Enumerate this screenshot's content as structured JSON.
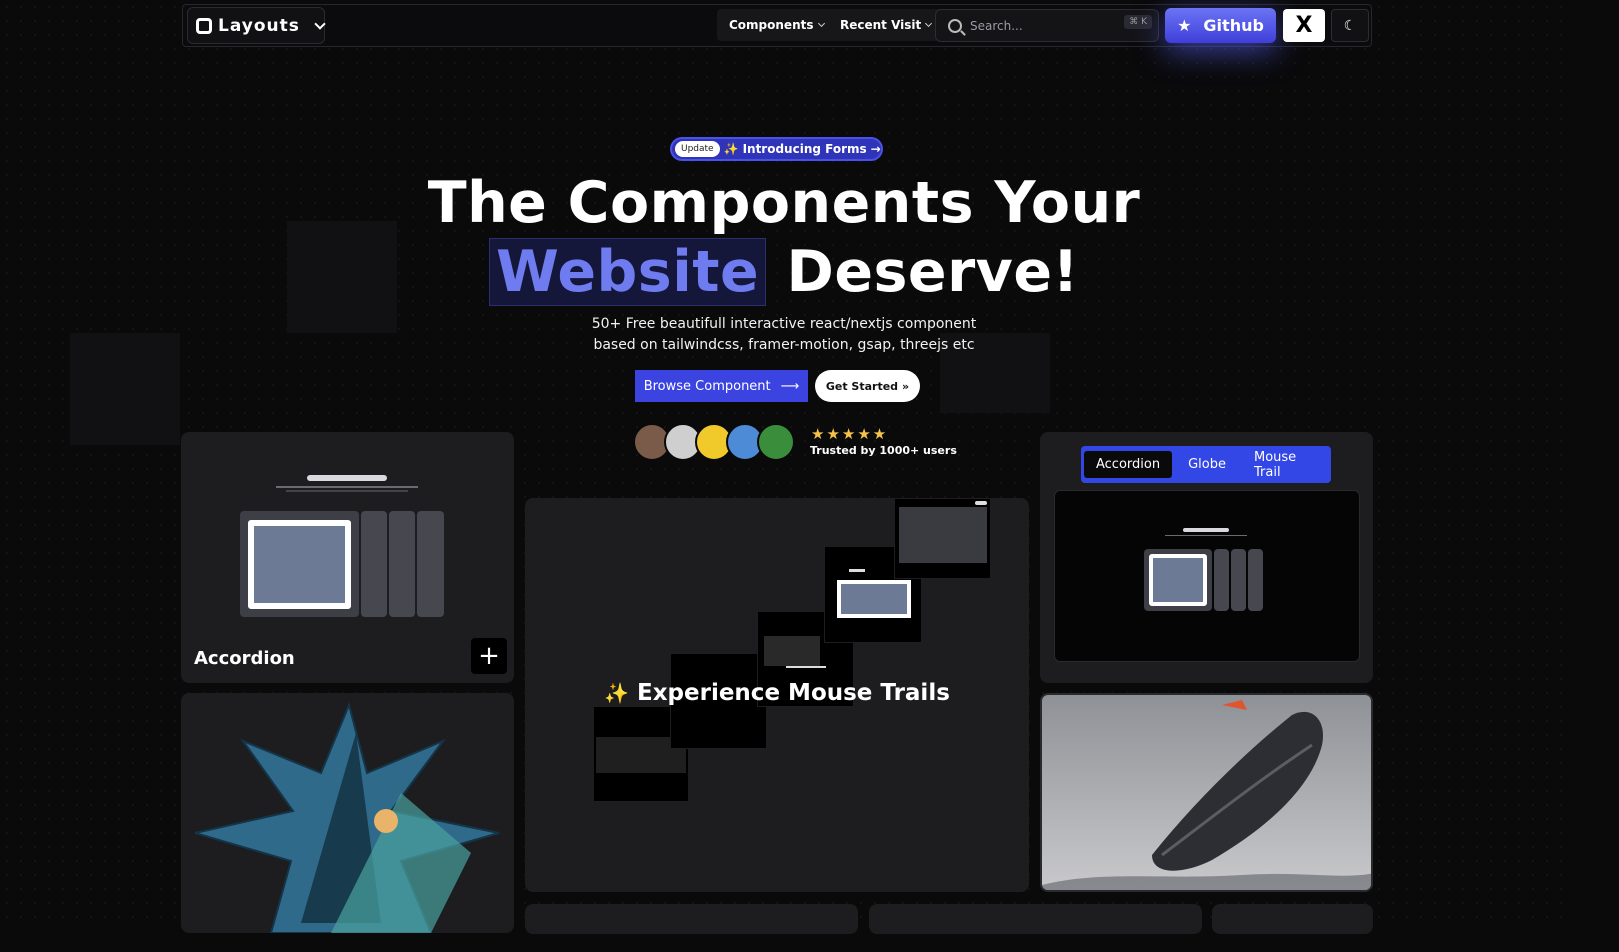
{
  "nav": {
    "logo": "Layouts",
    "menu_components": "Components",
    "menu_recent": "Recent Visit",
    "search_placeholder": "Search...",
    "search_shortcut": "⌘ K",
    "github_label": "Github",
    "x_label": "X"
  },
  "hero": {
    "badge_tag": "Update",
    "badge_text": "Introducing Forms",
    "title_line1": "The Components Your",
    "title_highlight": "Website",
    "title_rest": " Deserve!",
    "subtitle_line1": "50+ Free beautifull interactive react/nextjs component",
    "subtitle_line2": "based on tailwindcss, framer-motion, gsap, threejs etc",
    "cta_primary": "Browse Component",
    "cta_secondary": "Get Started",
    "rating_stars": "★★★★★",
    "trusted_text": "Trusted by 1000+ users"
  },
  "cards": {
    "accordion_title": "Accordion",
    "trail_title": "Experience Mouse Trails",
    "tabs": [
      "Accordion",
      "Globe",
      "Mouse Trail"
    ],
    "active_tab": "Accordion"
  },
  "colors": {
    "accent": "#3b43e0",
    "highlight_text": "#6e7cf0",
    "star": "#f6c24a"
  }
}
